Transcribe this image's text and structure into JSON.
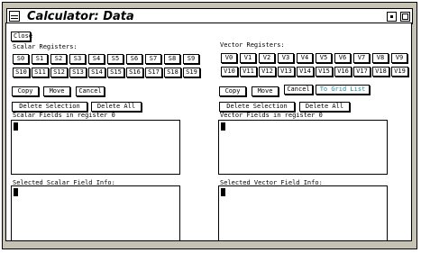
{
  "window": {
    "title": "Calculator: Data"
  },
  "toolbar": {
    "close_label": "Close"
  },
  "scalar": {
    "registers_label": "Scalar Registers:",
    "row1": [
      "S0",
      "S1",
      "S2",
      "S3",
      "S4",
      "S5",
      "S6",
      "S7",
      "S8",
      "S9"
    ],
    "row2": [
      "S10",
      "S11",
      "S12",
      "S13",
      "S14",
      "S15",
      "S16",
      "S17",
      "S18",
      "S19"
    ],
    "copy": "Copy",
    "move": "Move",
    "cancel": "Cancel",
    "delete_selection": "Delete Selection",
    "delete_all": "Delete All",
    "fields_label": "Scalar Fields in register  0",
    "info_label": "Selected Scalar Field Info:"
  },
  "vector": {
    "registers_label": "Vector Registers:",
    "row1": [
      "V0",
      "V1",
      "V2",
      "V3",
      "V4",
      "V5",
      "V6",
      "V7",
      "V8",
      "V9"
    ],
    "row2": [
      "V10",
      "V11",
      "V12",
      "V13",
      "V14",
      "V15",
      "V16",
      "V17",
      "V18",
      "V19"
    ],
    "copy": "Copy",
    "move": "Move",
    "cancel": "Cancel",
    "to_grid": "To Grid List",
    "delete_selection": "Delete Selection",
    "delete_all": "Delete All",
    "fields_label": "Vector Fields in register  0",
    "info_label": "Selected Vector Field Info:"
  }
}
